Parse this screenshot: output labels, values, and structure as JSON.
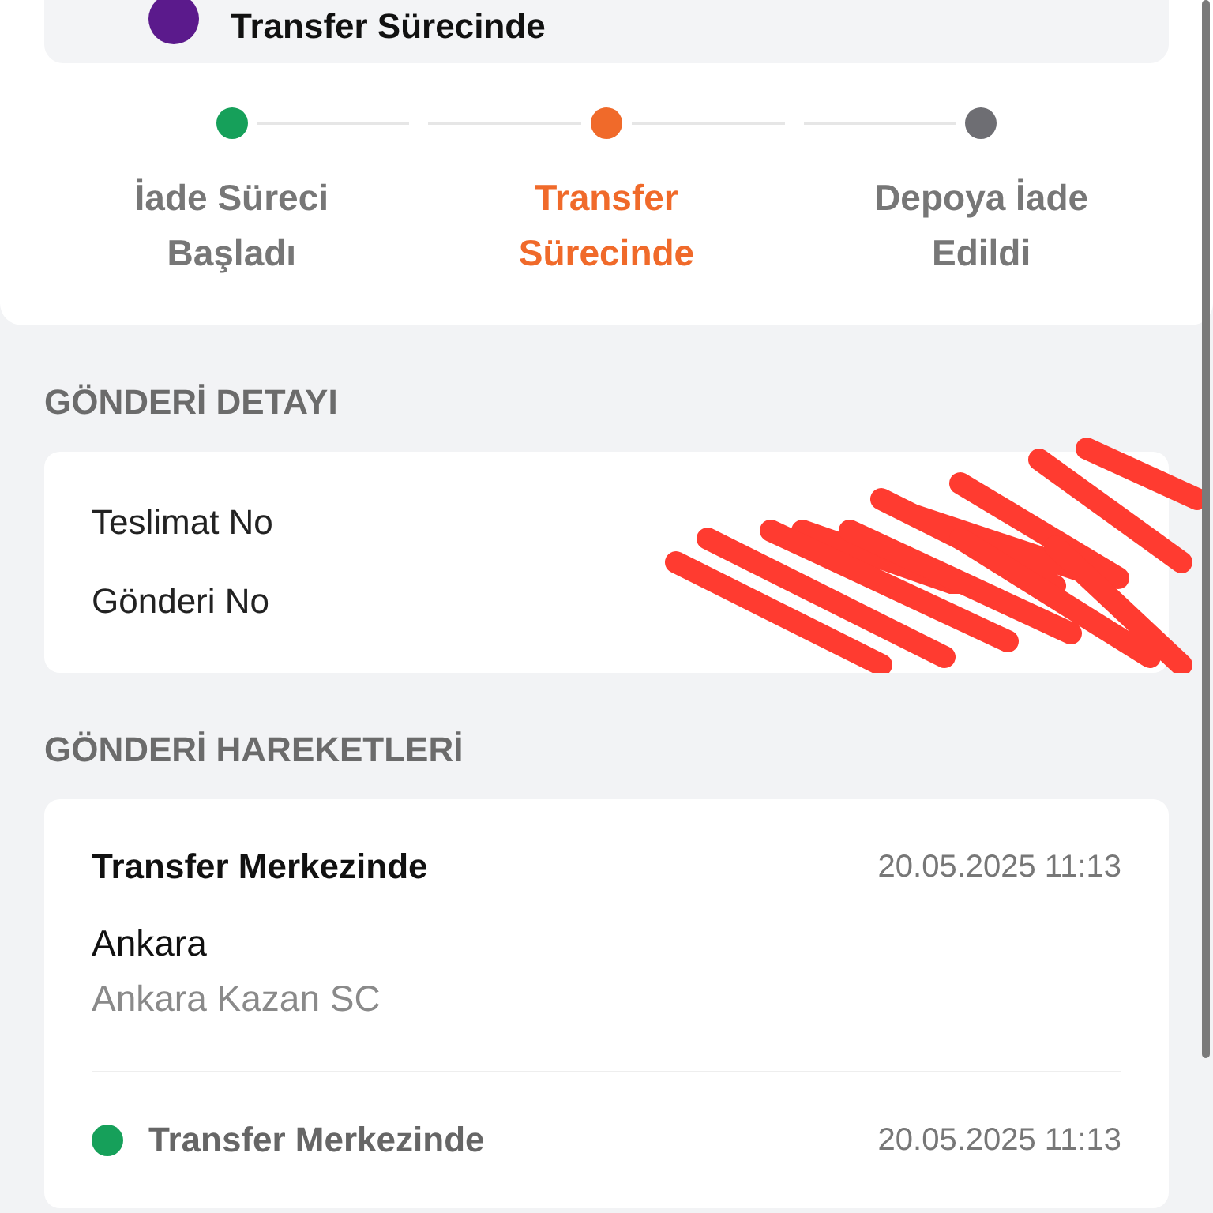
{
  "current_status": {
    "label": "Transfer Sürecinde",
    "color": "#5b1a8c"
  },
  "steps": [
    {
      "label": "İade Süreci Başladı",
      "kind": "done"
    },
    {
      "label": "Transfer Sürecinde",
      "kind": "current"
    },
    {
      "label": "Depoya İade Edildi",
      "kind": "pending"
    }
  ],
  "detail_section": {
    "title": "GÖNDERİ DETAYI",
    "rows": [
      {
        "label": "Teslimat No",
        "redacted": true
      },
      {
        "label": "Gönderi No",
        "redacted": true
      }
    ]
  },
  "movements_section": {
    "title": "GÖNDERİ HAREKETLERİ",
    "latest": {
      "title": "Transfer Merkezinde",
      "time": "20.05.2025 11:13",
      "city": "Ankara",
      "center": "Ankara Kazan SC"
    },
    "timeline": [
      {
        "title": "Transfer Merkezinde",
        "time": "20.05.2025 11:13",
        "color": "#16a05a"
      }
    ]
  }
}
